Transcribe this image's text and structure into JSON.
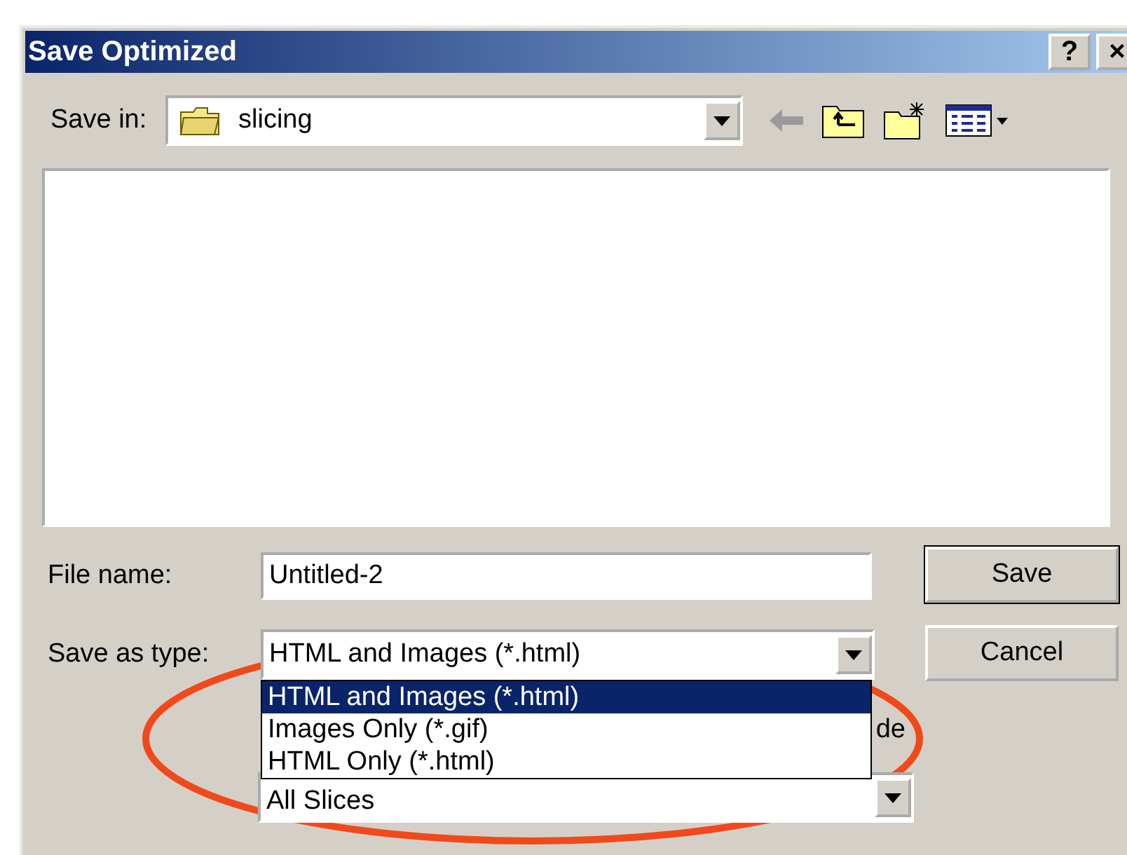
{
  "window": {
    "title": "Save Optimized",
    "help_button": "?",
    "close_button": "×"
  },
  "save_in": {
    "label": "Save in:",
    "value": "slicing"
  },
  "file_name": {
    "label": "File name:",
    "value": "Untitled-2"
  },
  "save_as_type": {
    "label": "Save as type:",
    "value": "HTML and Images (*.html)",
    "options": [
      {
        "label": "HTML and Images (*.html)",
        "selected": true
      },
      {
        "label": "Images Only (*.gif)",
        "selected": false
      },
      {
        "label": "HTML Only (*.html)",
        "selected": false
      }
    ]
  },
  "hidden_option_label": "de",
  "slices": {
    "value": "All Slices"
  },
  "buttons": [
    {
      "label": "Save",
      "kind": "default"
    },
    {
      "label": "Cancel",
      "kind": "normal"
    }
  ]
}
